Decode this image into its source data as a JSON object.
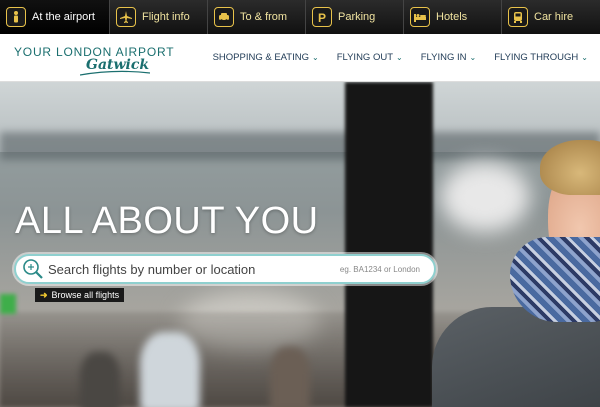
{
  "top_nav": {
    "items": [
      {
        "label": "At the airport",
        "icon": "person-icon",
        "active": true
      },
      {
        "label": "Flight info",
        "icon": "airplane-icon",
        "active": false
      },
      {
        "label": "To & from",
        "icon": "car-icon",
        "active": false
      },
      {
        "label": "Parking",
        "icon": "parking-icon",
        "active": false
      },
      {
        "label": "Hotels",
        "icon": "bed-icon",
        "active": false
      },
      {
        "label": "Car hire",
        "icon": "car-hire-icon",
        "active": false
      }
    ]
  },
  "header": {
    "logo_line1": "YOUR LONDON AIRPORT",
    "logo_line2": "Gatwick",
    "nav": [
      {
        "label": "SHOPPING & EATING"
      },
      {
        "label": "FLYING OUT"
      },
      {
        "label": "FLYING IN"
      },
      {
        "label": "FLYING THROUGH"
      }
    ]
  },
  "hero": {
    "headline": "ALL ABOUT YOU",
    "search": {
      "placeholder": "Search flights by number or location",
      "example": "eg. BA1234 or London"
    },
    "browse_label": "Browse all flights"
  },
  "colors": {
    "accent": "#1b6f6f",
    "icon_border": "#e8c24a",
    "search_border": "#8fd0cf"
  }
}
